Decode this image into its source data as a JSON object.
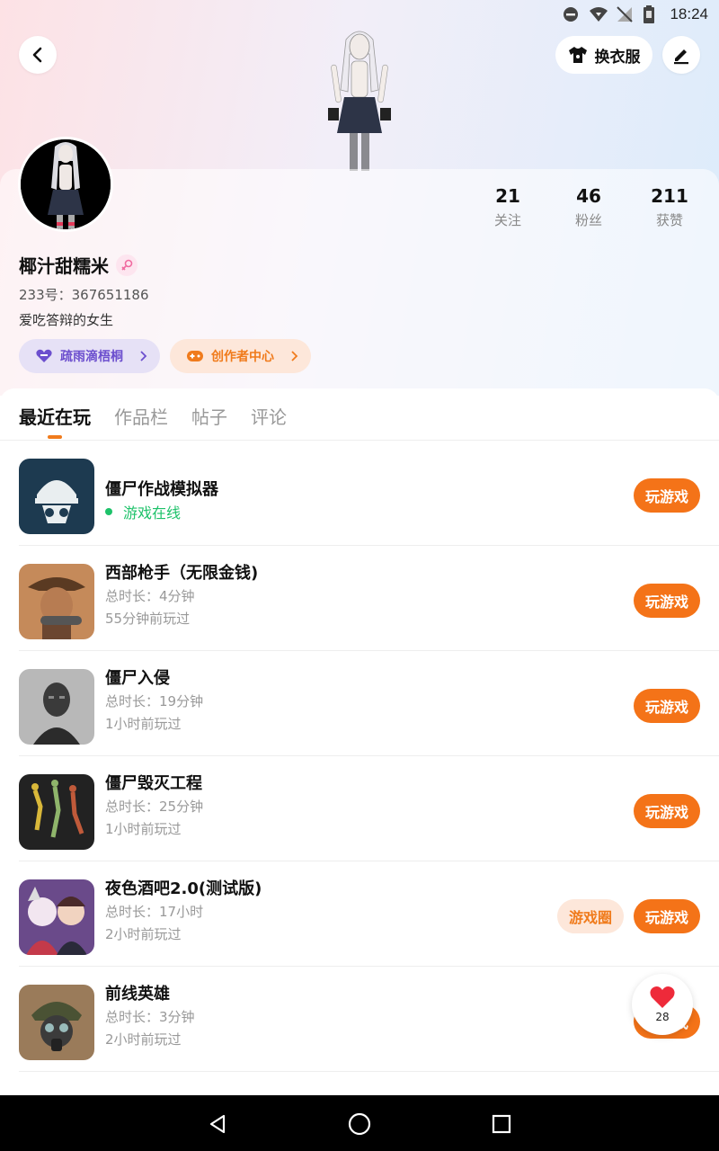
{
  "status_bar": {
    "time": "18:24"
  },
  "header": {
    "outfit_label": "换衣服"
  },
  "stats": [
    {
      "value": "21",
      "label": "关注"
    },
    {
      "value": "46",
      "label": "粉丝"
    },
    {
      "value": "211",
      "label": "获赞"
    }
  ],
  "profile": {
    "username": "椰汁甜糯米",
    "uid": "233号：367651186",
    "bio": "爱吃答辩的女生"
  },
  "chips": [
    {
      "label": "疏雨滴梧桐"
    },
    {
      "label": "创作者中心"
    }
  ],
  "tabs": [
    {
      "label": "最近在玩"
    },
    {
      "label": "作品栏"
    },
    {
      "label": "帖子"
    },
    {
      "label": "评论"
    }
  ],
  "games": [
    {
      "title": "僵尸作战模拟器",
      "status": "游戏在线",
      "play_label": "玩游戏"
    },
    {
      "title": "西部枪手（无限金钱)",
      "duration": "总时长：4分钟",
      "last_played": "55分钟前玩过",
      "play_label": "玩游戏"
    },
    {
      "title": "僵尸入侵",
      "duration": "总时长：19分钟",
      "last_played": "1小时前玩过",
      "play_label": "玩游戏"
    },
    {
      "title": "僵尸毁灭工程",
      "duration": "总时长：25分钟",
      "last_played": "1小时前玩过",
      "play_label": "玩游戏"
    },
    {
      "title": "夜色酒吧2.0(测试版)",
      "duration": "总时长：17小时",
      "last_played": "2小时前玩过",
      "circle_label": "游戏圈",
      "play_label": "玩游戏"
    },
    {
      "title": "前线英雄",
      "duration": "总时长：3分钟",
      "last_played": "2小时前玩过",
      "play_label": "玩游戏"
    }
  ],
  "like_float": {
    "count": "28"
  },
  "colors": {
    "accent": "#f47318",
    "online": "#1ec26a",
    "purple_chip": "#6c4fce"
  }
}
